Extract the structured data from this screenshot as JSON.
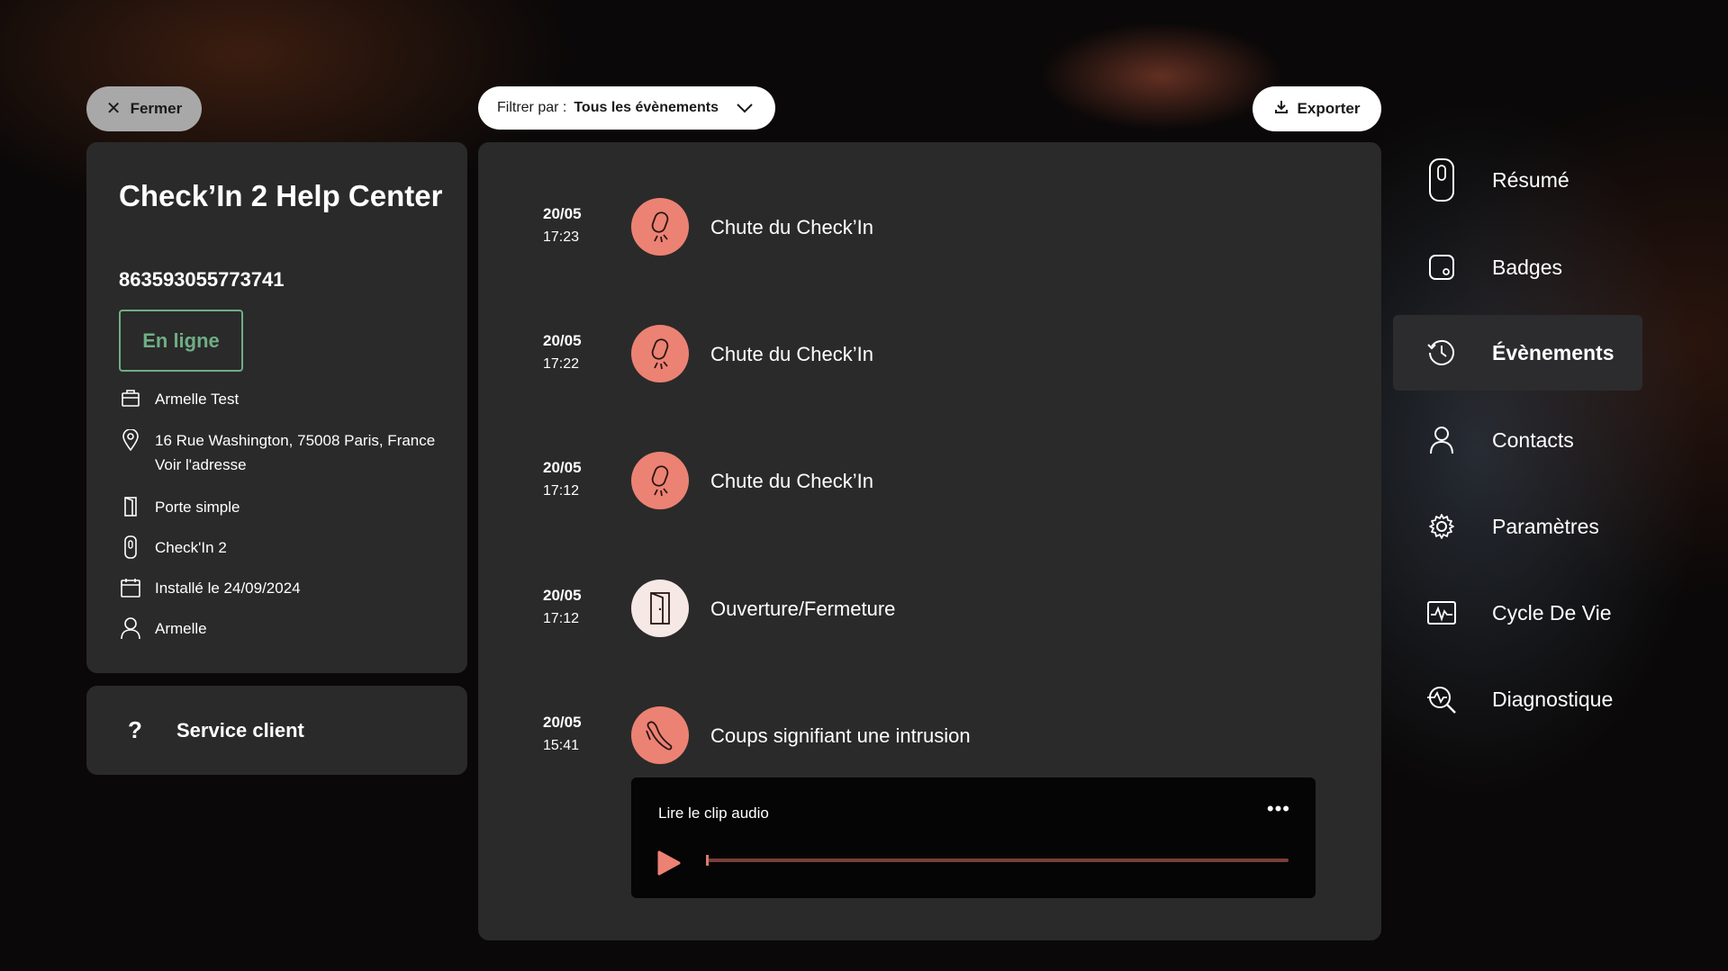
{
  "topbar": {
    "close_label": "Fermer",
    "filter_label": "Filtrer par :",
    "filter_value": "Tous les évènements",
    "export_label": "Exporter"
  },
  "device": {
    "title": "Check’In 2 Help Center",
    "imei": "863593055773741",
    "status": "En ligne",
    "status_color": "#6fae85",
    "owner": "Armelle Test",
    "address_line1": "16 Rue Washington, 75008 Paris, France",
    "address_line2": "Voir l'adresse",
    "door": "Porte simple",
    "model": "Check'In 2",
    "installed": "Installé le 24/09/2024",
    "user": "Armelle"
  },
  "help": {
    "label": "Service client",
    "icon": "question-icon"
  },
  "events": [
    {
      "date": "20/05",
      "time": "17:23",
      "label": "Chute du Check’In",
      "icon": "device-fall-icon",
      "badge_color": "#ec8273"
    },
    {
      "date": "20/05",
      "time": "17:22",
      "label": "Chute du Check’In",
      "icon": "device-fall-icon",
      "badge_color": "#ec8273"
    },
    {
      "date": "20/05",
      "time": "17:12",
      "label": "Chute du Check’In",
      "icon": "device-fall-icon",
      "badge_color": "#ec8273"
    },
    {
      "date": "20/05",
      "time": "17:12",
      "label": "Ouverture/Fermeture",
      "icon": "door-icon",
      "badge_color": "#f6e8e5"
    },
    {
      "date": "20/05",
      "time": "15:41",
      "label": "Coups signifiant une intrusion",
      "icon": "knock-icon",
      "badge_color": "#ec8273"
    }
  ],
  "audio": {
    "title": "Lire le clip audio",
    "more": "•••",
    "progress": 0
  },
  "nav": [
    {
      "label": "Résumé",
      "icon": "device-icon",
      "active": false
    },
    {
      "label": "Badges",
      "icon": "badge-icon",
      "active": false
    },
    {
      "label": "Évènements",
      "icon": "history-icon",
      "active": true
    },
    {
      "label": "Contacts",
      "icon": "user-icon",
      "active": false
    },
    {
      "label": "Paramètres",
      "icon": "gear-icon",
      "active": false
    },
    {
      "label": "Cycle De Vie",
      "icon": "activity-icon",
      "active": false
    },
    {
      "label": "Diagnostique",
      "icon": "diagnostic-icon",
      "active": false
    }
  ],
  "colors": {
    "accent": "#ec8273",
    "panel": "#2a2a2a",
    "background": "#0a0808"
  }
}
